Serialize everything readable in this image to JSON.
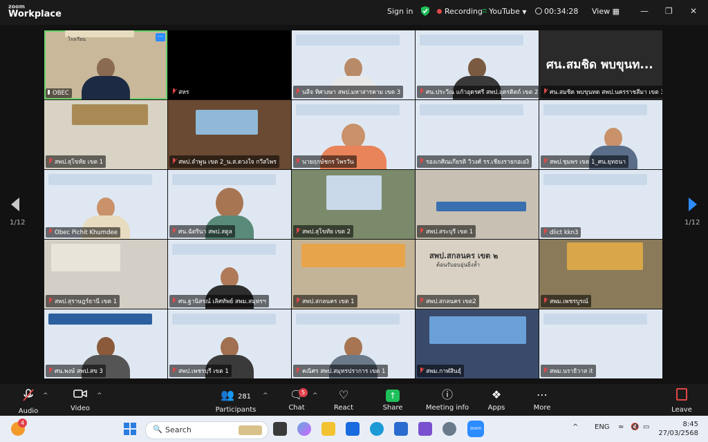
{
  "app": {
    "logo_line1": "zoom",
    "logo_line2": "Workplace"
  },
  "topbar": {
    "sign_in": "Sign in",
    "recording": "Recording",
    "youtube": "YouTube",
    "timer": "00:34:28",
    "view": "View"
  },
  "tiles": [
    {
      "name": "OBEC",
      "muted": false
    },
    {
      "name": "สหร",
      "muted": true
    },
    {
      "name": "นลีจ  ทิศวงษา สพป.มหาสารคาม เขต 3",
      "muted": true
    },
    {
      "name": "ศน.ประวีณ  แก้วอุดรศรี สพป.อุดรดิตถ์ เขต 2",
      "muted": true
    },
    {
      "name": "ศน.สมชิด พบขุนทด  สพป.นครราชสีมา เขต 3",
      "muted": true
    },
    {
      "name": "สพป.สุโขทัย เขต 1",
      "muted": true
    },
    {
      "name": "สพป.ลำพูน เขต 2_น.ส.ดวงใจ กวีสไพร",
      "muted": true
    },
    {
      "name": "นายฤกษ์ชกร ไพรวัน",
      "muted": true
    },
    {
      "name": "รองเกศิณเกียรติ  วิวงศ์ รร.เชียงรายกอเองิ",
      "muted": true
    },
    {
      "name": "สพป.ชุมพร เขต 1_ศน.ยุทธนา",
      "muted": true
    },
    {
      "name": "Obec Pichit Khumdee",
      "muted": true
    },
    {
      "name": "ศน.ฉัตรินา สพป.สตูล",
      "muted": true
    },
    {
      "name": "สพป.สุโขทัย เขต 2",
      "muted": true
    },
    {
      "name": "สพป.สระบุรี เขต 1",
      "muted": true
    },
    {
      "name": "dlict kkn3",
      "muted": true
    },
    {
      "name": "สพป.สุราษฎร์ธานี เขต 1",
      "muted": true
    },
    {
      "name": "ศน.ฐานิสรณ์ เลิศทัพย์ สพม.สมุทรฯ",
      "muted": true
    },
    {
      "name": "สพป.สกลนคร เขต 1",
      "muted": true
    },
    {
      "name": "สพป.สกลนคร เขต2",
      "muted": true
    },
    {
      "name": "สพม.เพชรบูรณ์",
      "muted": true
    },
    {
      "name": "ศน.พงษ์ สพป.สข 3",
      "muted": true
    },
    {
      "name": "สพป.เพชรบุรี เขต 1",
      "muted": true
    },
    {
      "name": "คณิศร สพป.สมุทรปราการ เขต 1",
      "muted": true
    },
    {
      "name": "สพม.กาฬสินธุ์",
      "muted": true
    },
    {
      "name": "สพม.นราธิวาส it",
      "muted": true
    }
  ],
  "tile_title_text": "ศน.สมชิด พบขุนท...",
  "tile_sign_text": "โรงเรียน",
  "tile_sign2_text": "สพป.สกลนคร เขต ๒",
  "tile_sign2_sub": "ต้อนรับอบอุ่นยิ่งล้ำ",
  "page": {
    "left": "1/12",
    "right": "1/12"
  },
  "toolbar": {
    "audio": "Audio",
    "video": "Video",
    "participants": "Participants",
    "participants_count": "281",
    "chat": "Chat",
    "chat_badge": "5",
    "react": "React",
    "share": "Share",
    "meeting_info": "Meeting info",
    "apps": "Apps",
    "more": "More",
    "leave": "Leave"
  },
  "taskbar": {
    "notif_badge": "4",
    "search_placeholder": "Search",
    "lang": "ENG",
    "time": "8:45",
    "date": "27/03/2568"
  },
  "colors": {
    "accent": "#2d8cff",
    "recording": "#e04848",
    "active_speaker": "#6bd36b",
    "share_green": "#1fbf5a"
  }
}
